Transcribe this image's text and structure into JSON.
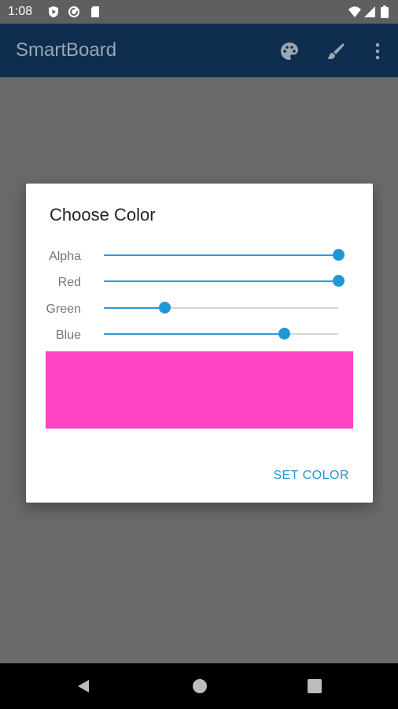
{
  "status_bar": {
    "time": "1:08",
    "icons": [
      "play-protect-icon",
      "sync-icon",
      "sd-card-icon",
      "wifi-icon",
      "signal-icon",
      "battery-icon"
    ]
  },
  "app_bar": {
    "title": "SmartBoard",
    "actions": [
      "palette-icon",
      "brush-icon",
      "more-vert-icon"
    ]
  },
  "dialog": {
    "title": "Choose Color",
    "sliders": [
      {
        "label": "Alpha",
        "value": 1.0
      },
      {
        "label": "Red",
        "value": 1.0
      },
      {
        "label": "Green",
        "value": 0.26
      },
      {
        "label": "Blue",
        "value": 0.77
      }
    ],
    "preview_color": "#ff44c4",
    "set_color_label": "SET COLOR"
  },
  "nav_bar": {
    "buttons": [
      "back-icon",
      "home-icon",
      "recents-icon"
    ]
  },
  "colors": {
    "app_bar": "#0e2d4f",
    "accent": "#1f97d6"
  }
}
